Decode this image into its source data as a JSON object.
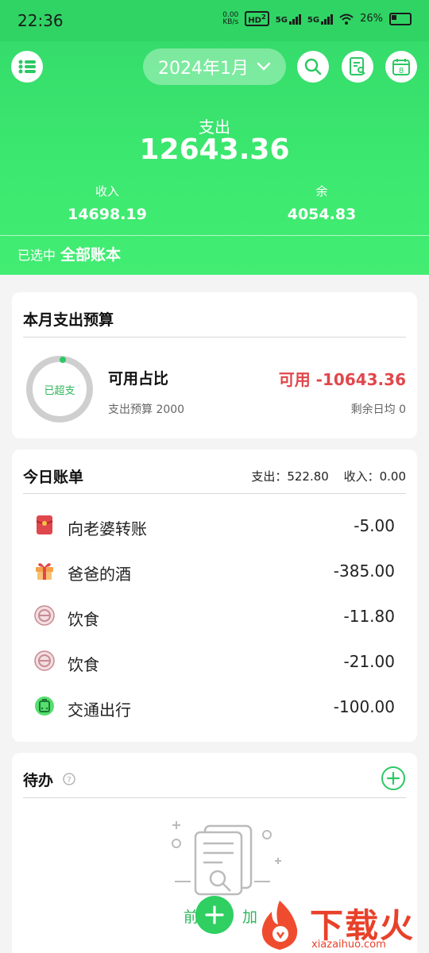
{
  "status": {
    "time": "22:36",
    "net_speed": "0.00",
    "net_unit": "KB/s",
    "hd_badge": "HD",
    "hd_sub": "2",
    "sig1": "5G",
    "sig2": "5G",
    "battery": "26%"
  },
  "topbar": {
    "month": "2024年1月"
  },
  "summary": {
    "expense_label": "支出",
    "expense_value": "12643.36",
    "income_label": "收入",
    "income_value": "14698.19",
    "balance_label": "余",
    "balance_value": "4054.83",
    "selected_prefix": "已选中",
    "selected_book": "全部账本"
  },
  "budget": {
    "title": "本月支出预算",
    "ring_label": "已超支",
    "ratio_label": "可用占比",
    "budget_text": "支出预算 2000",
    "available_text": "可用 -10643.36",
    "daily_text": "剩余日均 0",
    "accent": "#e0474c"
  },
  "today": {
    "title": "今日账单",
    "expense_summary": "支出：522.80",
    "income_summary": "收入：0.00",
    "items": [
      {
        "name": "向老婆转账",
        "amount": "-5.00",
        "icon": "red-envelope-icon"
      },
      {
        "name": "爸爸的酒",
        "amount": "-385.00",
        "icon": "gift-icon"
      },
      {
        "name": "饮食",
        "amount": "-11.80",
        "icon": "food-bowl-icon"
      },
      {
        "name": "饮食",
        "amount": "-21.00",
        "icon": "food-bowl-icon"
      },
      {
        "name": "交通出行",
        "amount": "-100.00",
        "icon": "transport-icon"
      }
    ]
  },
  "todo": {
    "title": "待办",
    "empty_left": "前",
    "empty_right": "加"
  },
  "watermark": {
    "brand": "下载火",
    "site": "xiazaihuo.com"
  },
  "colors": {
    "green": "#33d86a",
    "red": "#e0474c"
  }
}
